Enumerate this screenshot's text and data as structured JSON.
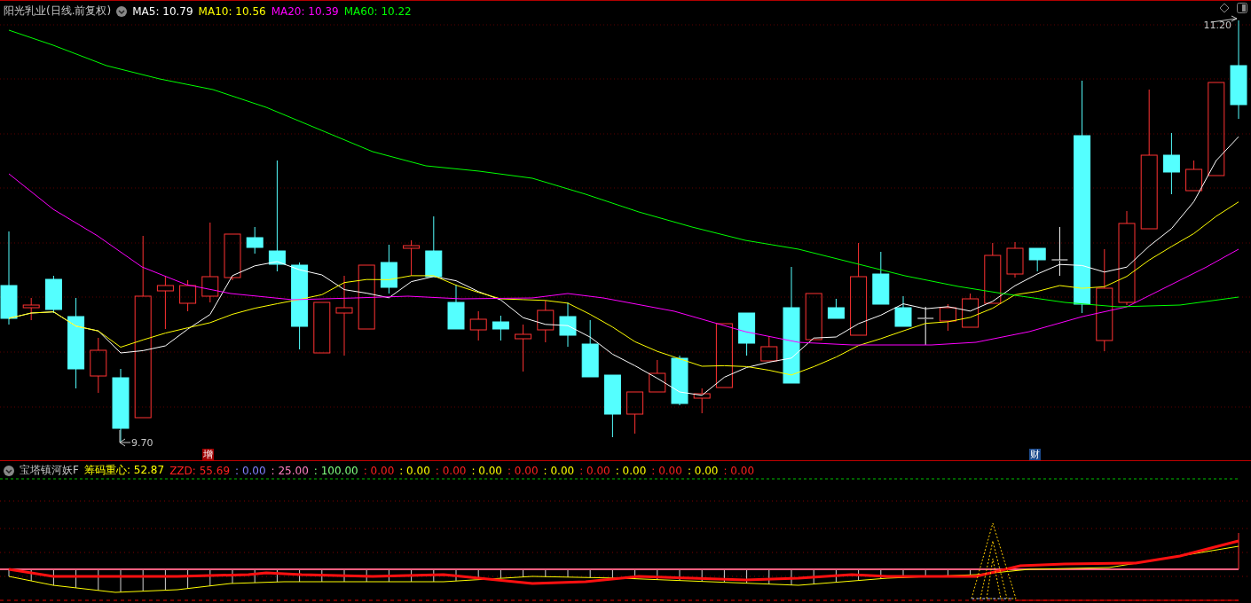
{
  "stock": {
    "title": "阳光乳业(日线.前复权)"
  },
  "ma_legend": [
    {
      "label": "MA5: 10.79",
      "color": "#ffffff"
    },
    {
      "label": "MA10: 10.56",
      "color": "#ffff00"
    },
    {
      "label": "MA20: 10.39",
      "color": "#ff00ff"
    },
    {
      "label": "MA60: 10.22",
      "color": "#00ff00"
    }
  ],
  "price_marks": [
    {
      "kind": "high",
      "text": "11.20"
    },
    {
      "kind": "low",
      "text": "9.70"
    }
  ],
  "event_markers": [
    {
      "text": "增",
      "color": "#a00000"
    },
    {
      "text": "财",
      "color": "#1c4a8c"
    }
  ],
  "indicator": {
    "name": "宝塔镇河妖F",
    "values": [
      {
        "label": "筹码重心: 52.87",
        "color": "#ffff00"
      },
      {
        "label": "ZZD: 55.69",
        "color": "#ff2020"
      },
      {
        "label": ": 0.00",
        "color": "#8080ff"
      },
      {
        "label": ": 25.00",
        "color": "#ff80c0"
      },
      {
        "label": ": 100.00",
        "color": "#80ff80"
      },
      {
        "label": ": 0.00",
        "color": "#ff2020"
      },
      {
        "label": ": 0.00",
        "color": "#ffff00"
      },
      {
        "label": ": 0.00",
        "color": "#ff2020"
      },
      {
        "label": ": 0.00",
        "color": "#ffff00"
      },
      {
        "label": ": 0.00",
        "color": "#ff2020"
      },
      {
        "label": ": 0.00",
        "color": "#ffff00"
      },
      {
        "label": ": 0.00",
        "color": "#ff2020"
      },
      {
        "label": ": 0.00",
        "color": "#ffff00"
      },
      {
        "label": ": 0.00",
        "color": "#ff2020"
      },
      {
        "label": ": 0.00",
        "color": "#ffff00"
      },
      {
        "label": ": 0.00",
        "color": "#ff2020"
      }
    ]
  }
}
